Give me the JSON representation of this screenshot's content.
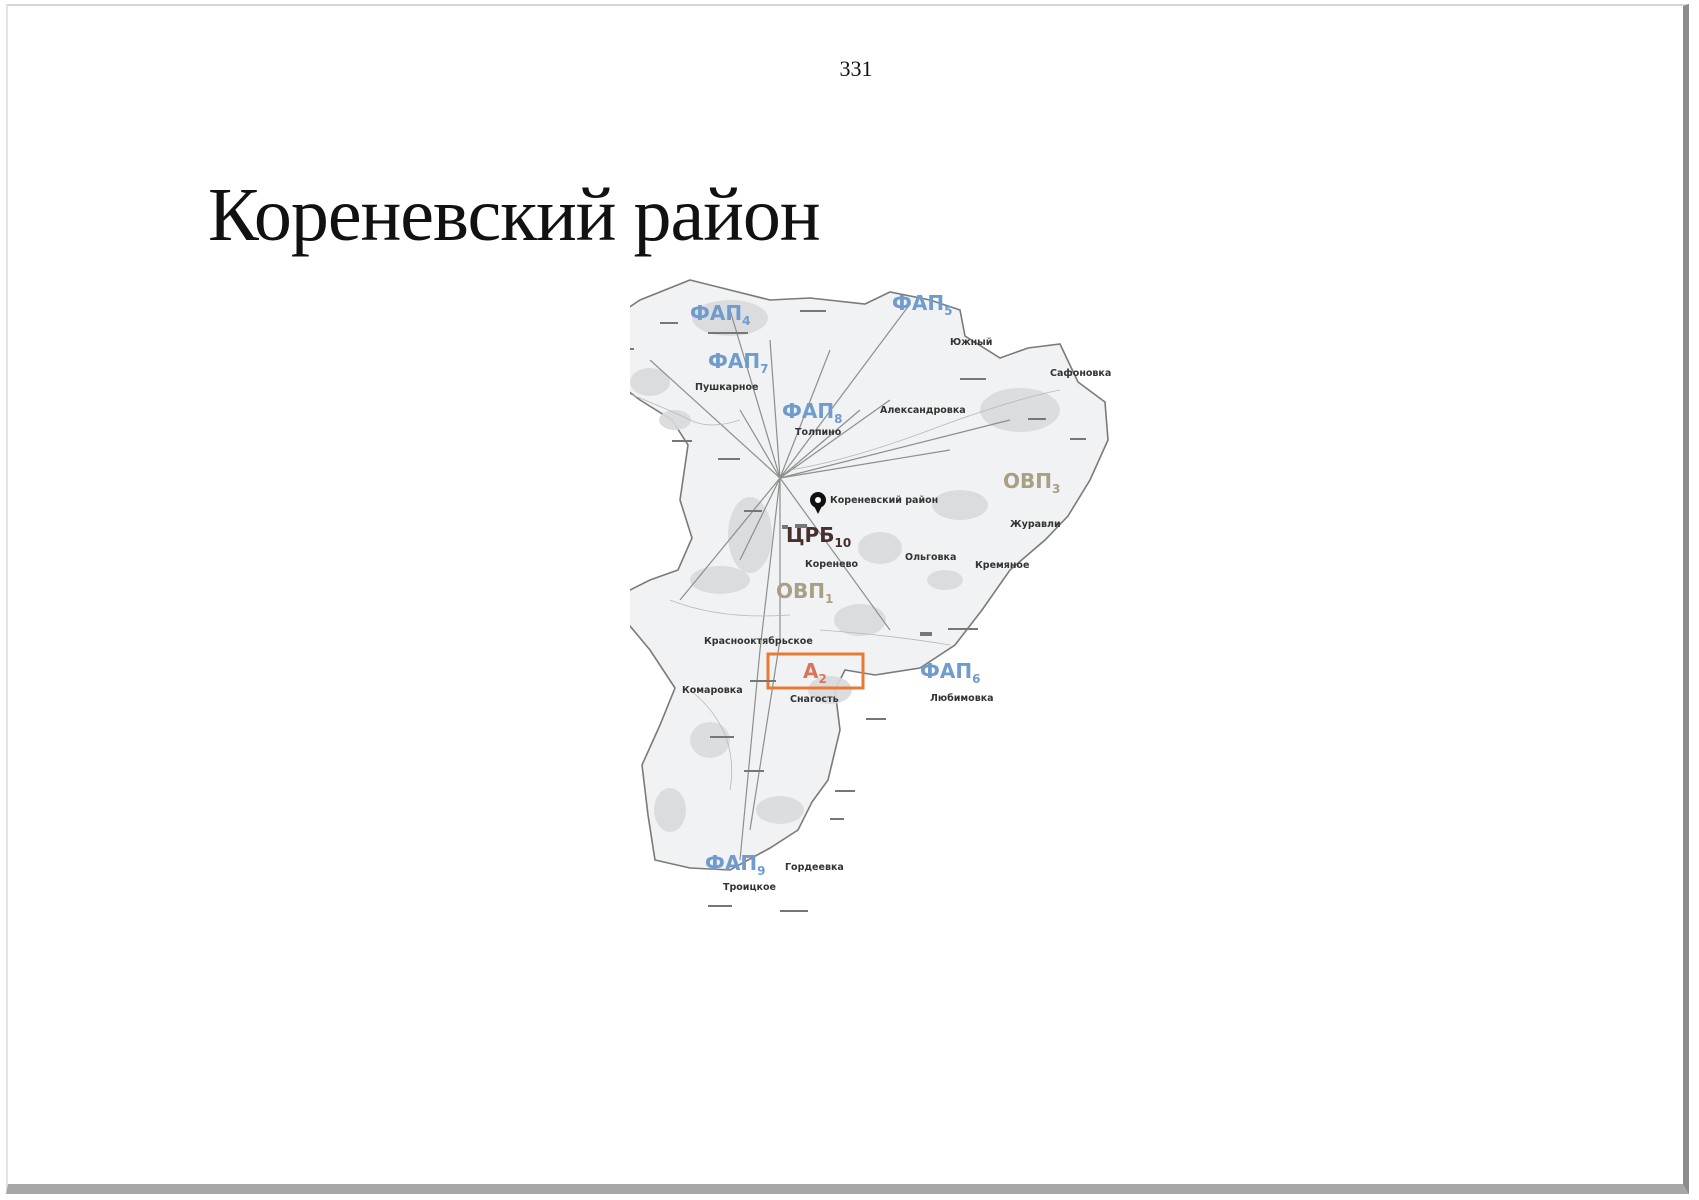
{
  "page": {
    "number": "331",
    "title": "Кореневский район"
  },
  "map": {
    "colors": {
      "region_fill": "#f1f2f3",
      "region_border": "#7a7a7a",
      "forest": "#d9dadc",
      "lines": "#8e8e8e",
      "fap_label": "#6f9ccc",
      "ovp_label": "#a99f84",
      "crb_label": "#4a2f2f",
      "a_label": "#d9755d",
      "a_box": "#ea7a32"
    },
    "facilities": [
      {
        "id": "fap4",
        "text": "ФАП",
        "sub": "4",
        "kind": "fap"
      },
      {
        "id": "fap5",
        "text": "ФАП",
        "sub": "5",
        "kind": "fap"
      },
      {
        "id": "fap7",
        "text": "ФАП",
        "sub": "7",
        "kind": "fap"
      },
      {
        "id": "fap8",
        "text": "ФАП",
        "sub": "8",
        "kind": "fap"
      },
      {
        "id": "ovp3",
        "text": "ОВП",
        "sub": "3",
        "kind": "ovp"
      },
      {
        "id": "crb10",
        "text": "ЦРБ",
        "sub": "10",
        "kind": "crb"
      },
      {
        "id": "ovp1",
        "text": "ОВП",
        "sub": "1",
        "kind": "ovp"
      },
      {
        "id": "a2",
        "text": "А",
        "sub": "2",
        "kind": "a"
      },
      {
        "id": "fap6",
        "text": "ФАП",
        "sub": "6",
        "kind": "fap"
      },
      {
        "id": "fap9",
        "text": "ФАП",
        "sub": "9",
        "kind": "fap"
      }
    ],
    "places": {
      "pushkarnoe": "Пушкарное",
      "tolpino": "Толпино",
      "aleksandrovka": "Александровка",
      "yuzhny": "Южный",
      "safonovka": "Сафоновка",
      "zhuravli": "Журавли",
      "korenevo": "Коренево",
      "olgovka": "Ольговка",
      "kremyanoe": "Кремяное",
      "krasnooktyabrskoe": "Краснооктябрьское",
      "komarovka": "Комаровка",
      "snagost": "Снагость",
      "lyubimovka": "Любимовка",
      "troitskoe": "Троицкое",
      "gordeevka": "Гордеевка",
      "marker": "Кореневский район"
    }
  }
}
